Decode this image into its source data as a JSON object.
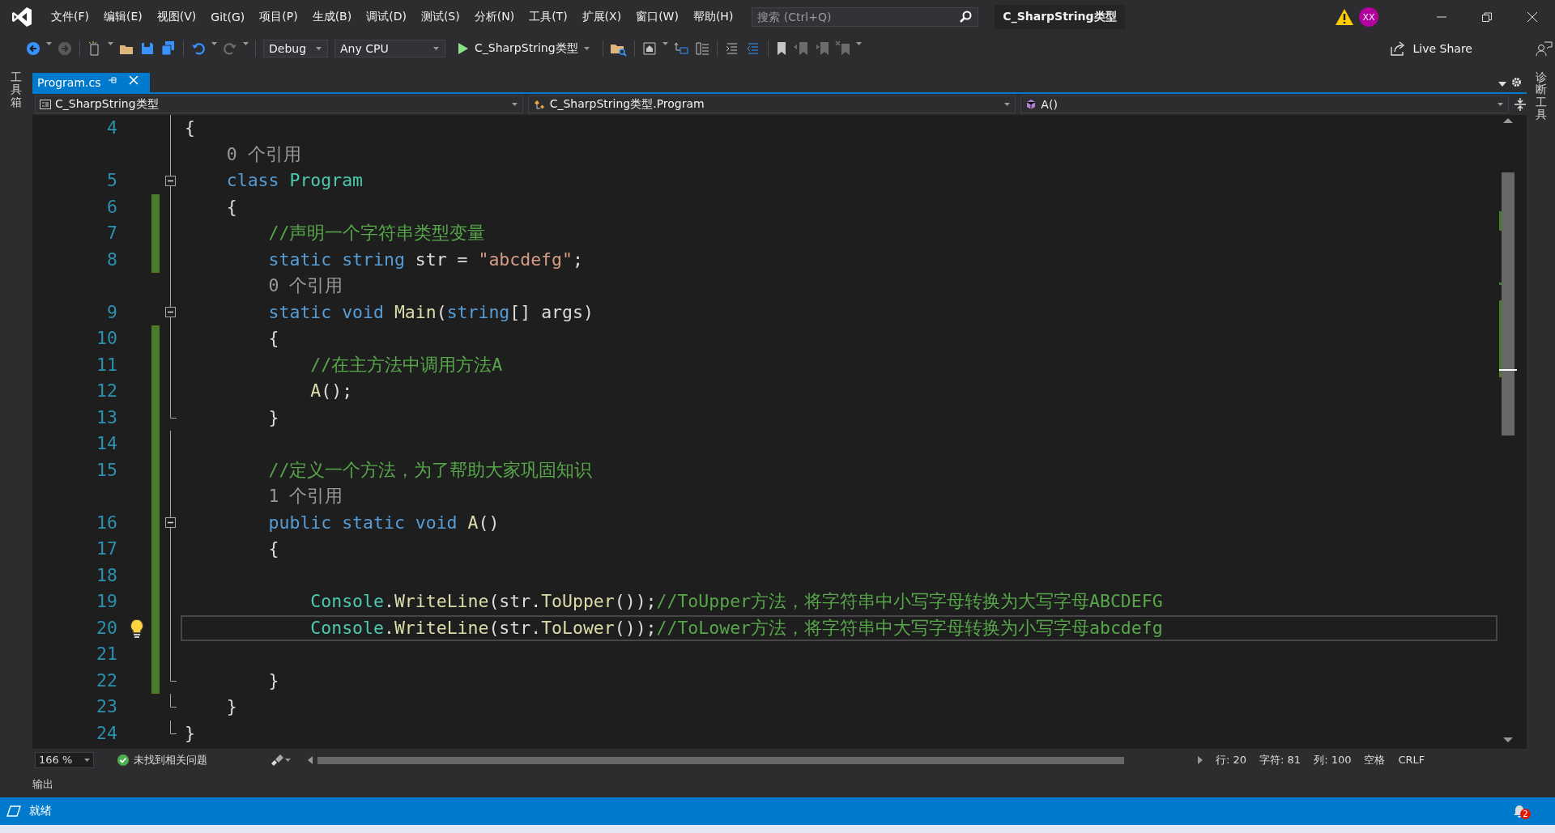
{
  "window": {
    "menu": [
      "文件(F)",
      "编辑(E)",
      "视图(V)",
      "Git(G)",
      "项目(P)",
      "生成(B)",
      "调试(D)",
      "测试(S)",
      "分析(N)",
      "工具(T)",
      "扩展(X)",
      "窗口(W)",
      "帮助(H)"
    ],
    "search": {
      "placeholder": "搜索 (Ctrl+Q)"
    },
    "title": "C_SharpString类型",
    "avatar": "XX"
  },
  "toolbar": {
    "configuration": "Debug",
    "platform": "Any CPU",
    "start_target": "C_SharpString类型",
    "live_share": "Live Share"
  },
  "left_panel": "工具箱",
  "right_panel": "诊断工具",
  "tabs": [
    {
      "label": "Program.cs",
      "selected": true
    }
  ],
  "navigation": {
    "project": "C_SharpString类型",
    "type": "C_SharpString类型.Program",
    "member": "A()"
  },
  "editor": {
    "rows": [
      {
        "kind": "code",
        "number": "4",
        "changed": false,
        "current": false,
        "collapsible": false,
        "block_end": false,
        "tokens": [
          {
            "kind": "plain",
            "text": "{"
          }
        ]
      },
      {
        "kind": "lens",
        "text": "    0 个引用",
        "changed": false,
        "current": false,
        "collapsible": false,
        "block_end": false
      },
      {
        "kind": "code",
        "number": "5",
        "changed": false,
        "current": false,
        "collapsible": true,
        "block_end": false,
        "tokens": [
          {
            "kind": "keyword",
            "text": "    class "
          },
          {
            "kind": "type",
            "text": "Program"
          }
        ]
      },
      {
        "kind": "code",
        "number": "6",
        "changed": true,
        "current": false,
        "collapsible": false,
        "block_end": false,
        "tokens": [
          {
            "kind": "plain",
            "text": "    {"
          }
        ]
      },
      {
        "kind": "code",
        "number": "7",
        "changed": true,
        "current": false,
        "collapsible": false,
        "block_end": false,
        "tokens": [
          {
            "kind": "comment",
            "text": "        //声明一个字符串类型变量"
          }
        ]
      },
      {
        "kind": "code",
        "number": "8",
        "changed": true,
        "current": false,
        "collapsible": false,
        "block_end": false,
        "tokens": [
          {
            "kind": "keyword",
            "text": "        static string "
          },
          {
            "kind": "plain",
            "text": "str = "
          },
          {
            "kind": "string",
            "text": "\"abcdefg\""
          },
          {
            "kind": "plain",
            "text": ";"
          }
        ]
      },
      {
        "kind": "lens",
        "text": "        0 个引用",
        "changed": false,
        "current": false,
        "collapsible": false,
        "block_end": false
      },
      {
        "kind": "code",
        "number": "9",
        "changed": false,
        "current": false,
        "collapsible": true,
        "block_end": false,
        "tokens": [
          {
            "kind": "keyword",
            "text": "        static void "
          },
          {
            "kind": "method",
            "text": "Main"
          },
          {
            "kind": "plain",
            "text": "("
          },
          {
            "kind": "keyword",
            "text": "string"
          },
          {
            "kind": "plain",
            "text": "[] args)"
          }
        ]
      },
      {
        "kind": "code",
        "number": "10",
        "changed": true,
        "current": false,
        "collapsible": false,
        "block_end": false,
        "tokens": [
          {
            "kind": "plain",
            "text": "        {"
          }
        ]
      },
      {
        "kind": "code",
        "number": "11",
        "changed": true,
        "current": false,
        "collapsible": false,
        "block_end": false,
        "tokens": [
          {
            "kind": "comment",
            "text": "            //在主方法中调用方法A"
          }
        ]
      },
      {
        "kind": "code",
        "number": "12",
        "changed": true,
        "current": false,
        "collapsible": false,
        "block_end": false,
        "tokens": [
          {
            "kind": "method",
            "text": "            A"
          },
          {
            "kind": "plain",
            "text": "();"
          }
        ]
      },
      {
        "kind": "code",
        "number": "13",
        "changed": true,
        "current": false,
        "collapsible": false,
        "block_end": true,
        "tokens": [
          {
            "kind": "plain",
            "text": "        }"
          }
        ]
      },
      {
        "kind": "code",
        "number": "14",
        "changed": true,
        "current": false,
        "collapsible": false,
        "block_end": false
      },
      {
        "kind": "code",
        "number": "15",
        "changed": true,
        "current": false,
        "collapsible": false,
        "block_end": false,
        "tokens": [
          {
            "kind": "comment",
            "text": "        //定义一个方法，为了帮助大家巩固知识"
          }
        ]
      },
      {
        "kind": "lens",
        "text": "        1 个引用",
        "changed": true,
        "current": false,
        "collapsible": false,
        "block_end": false
      },
      {
        "kind": "code",
        "number": "16",
        "changed": true,
        "current": false,
        "collapsible": true,
        "block_end": false,
        "tokens": [
          {
            "kind": "keyword",
            "text": "        public static void "
          },
          {
            "kind": "method",
            "text": "A"
          },
          {
            "kind": "plain",
            "text": "()"
          }
        ]
      },
      {
        "kind": "code",
        "number": "17",
        "changed": true,
        "current": false,
        "collapsible": false,
        "block_end": false,
        "tokens": [
          {
            "kind": "plain",
            "text": "        {"
          }
        ]
      },
      {
        "kind": "code",
        "number": "18",
        "changed": true,
        "current": false,
        "collapsible": false,
        "block_end": false
      },
      {
        "kind": "code",
        "number": "19",
        "changed": true,
        "current": false,
        "collapsible": false,
        "block_end": false,
        "tokens": [
          {
            "kind": "type",
            "text": "            Console"
          },
          {
            "kind": "plain",
            "text": "."
          },
          {
            "kind": "method",
            "text": "WriteLine"
          },
          {
            "kind": "plain",
            "text": "(str."
          },
          {
            "kind": "method",
            "text": "ToUpper"
          },
          {
            "kind": "plain",
            "text": "());"
          },
          {
            "kind": "comment",
            "text": "//ToUpper方法，将字符串中小写字母转换为大写字母ABCDEFG"
          }
        ]
      },
      {
        "kind": "code",
        "number": "20",
        "changed": true,
        "current": true,
        "collapsible": false,
        "block_end": false,
        "lightbulb": true,
        "tokens": [
          {
            "kind": "type",
            "text": "            Console"
          },
          {
            "kind": "plain",
            "text": "."
          },
          {
            "kind": "method",
            "text": "WriteLine"
          },
          {
            "kind": "plain",
            "text": "(str."
          },
          {
            "kind": "method",
            "text": "ToLower"
          },
          {
            "kind": "plain",
            "text": "());"
          },
          {
            "kind": "comment",
            "text": "//ToLower方法，将字符串中大写字母转换为小写字母abcdefg"
          }
        ]
      },
      {
        "kind": "code",
        "number": "21",
        "changed": true,
        "current": false,
        "collapsible": false,
        "block_end": false
      },
      {
        "kind": "code",
        "number": "22",
        "changed": true,
        "current": false,
        "collapsible": false,
        "block_end": true,
        "tokens": [
          {
            "kind": "plain",
            "text": "        }"
          }
        ]
      },
      {
        "kind": "code",
        "number": "23",
        "changed": false,
        "current": false,
        "collapsible": false,
        "block_end": true,
        "tokens": [
          {
            "kind": "plain",
            "text": "    }"
          }
        ]
      },
      {
        "kind": "code",
        "number": "24",
        "changed": false,
        "current": false,
        "collapsible": false,
        "block_end": true,
        "tokens": [
          {
            "kind": "plain",
            "text": "}"
          }
        ]
      }
    ]
  },
  "editor_status": {
    "zoom": "166 %",
    "issues": "未找到相关问题",
    "line": "行: 20",
    "char": "字符: 81",
    "column": "列: 100",
    "indent": "空格",
    "line_ending": "CRLF"
  },
  "output_tab": "输出",
  "status_bar": {
    "text": "就绪",
    "notifications": "2"
  }
}
